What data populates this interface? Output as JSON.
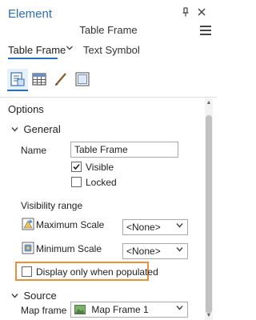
{
  "header": {
    "title": "Element",
    "subtitle": "Table Frame"
  },
  "tabs": [
    {
      "label": "Table Frame",
      "active": true
    },
    {
      "label": "Text Symbol",
      "active": false
    }
  ],
  "options": {
    "heading": "Options",
    "general": {
      "heading": "General",
      "name_label": "Name",
      "name_value": "Table Frame",
      "visible_label": "Visible",
      "visible_checked": true,
      "locked_label": "Locked",
      "locked_checked": false
    },
    "visibility_range": {
      "heading": "Visibility range",
      "max_label": "Maximum Scale",
      "max_value": "<None>",
      "min_label": "Minimum Scale",
      "min_value": "<None>"
    },
    "display_only_populated_label": "Display only when populated",
    "display_only_populated_checked": false
  },
  "source": {
    "heading": "Source",
    "map_frame_label": "Map frame",
    "map_frame_value": "Map Frame 1"
  },
  "colors": {
    "accent": "#2a6fb5",
    "highlight": "#e8913a"
  },
  "icons": [
    "pin-icon",
    "close-icon",
    "menu-icon",
    "chevron-down-icon",
    "options-icon",
    "table-icon",
    "pen-icon",
    "display-icon",
    "map-frame-icon",
    "scale-icon"
  ]
}
